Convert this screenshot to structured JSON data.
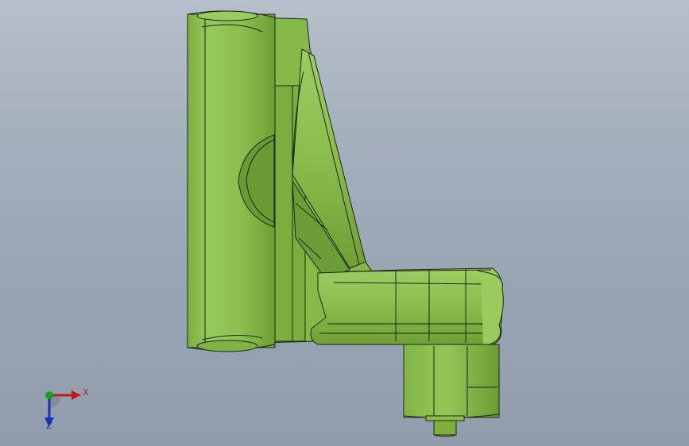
{
  "viewport": {
    "background_top": "#b6bfca",
    "background_bottom": "#909dac"
  },
  "model": {
    "icon": "bracket-part-shaded",
    "body_color": "#8cbf4e",
    "highlight_color": "#a8d46a",
    "shadow_color": "#5f8f2c",
    "edge_color": "#1b2610"
  },
  "triad": {
    "x_label": "X",
    "z_label": "Z",
    "x_color": "#c41818",
    "y_color": "#17a017",
    "z_color": "#1a30b8"
  }
}
